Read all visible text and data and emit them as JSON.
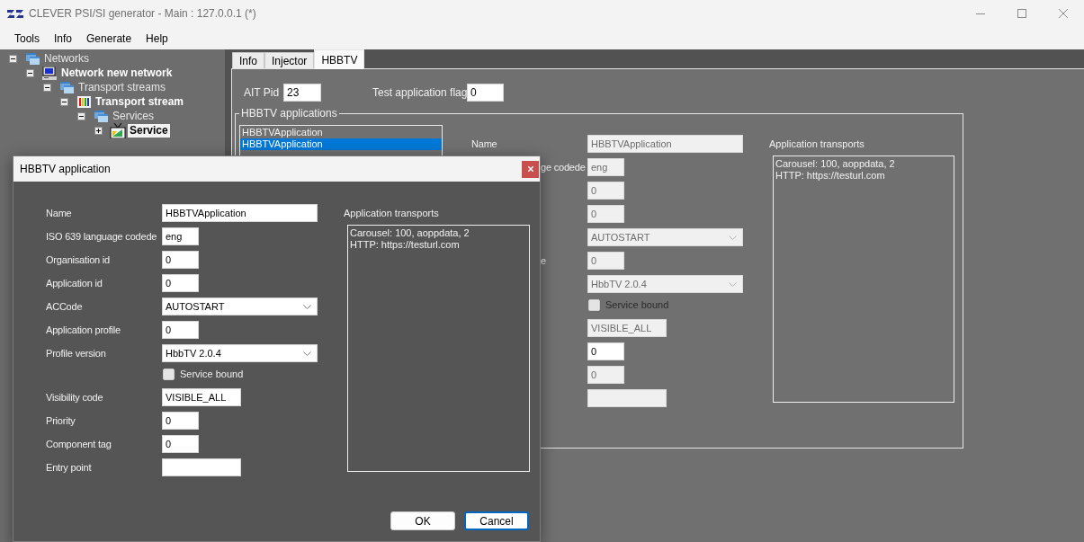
{
  "window": {
    "title": "CLEVER PSI/SI generator - Main : 127.0.0.1 (*)"
  },
  "menu": [
    {
      "label": "Tools"
    },
    {
      "label": "Info"
    },
    {
      "label": "Generate"
    },
    {
      "label": "Help"
    }
  ],
  "tree": [
    {
      "label": "Networks",
      "kind": "folder",
      "expanded": true,
      "selected": false,
      "children": [
        {
          "label": "Network new network",
          "kind": "network",
          "expanded": true,
          "selected": false,
          "children": [
            {
              "label": "Transport streams",
              "kind": "folder",
              "expanded": true,
              "selected": false,
              "children": [
                {
                  "label": "Transport stream",
                  "kind": "stream",
                  "expanded": true,
                  "selected": false,
                  "children": [
                    {
                      "label": "Services",
                      "kind": "folder",
                      "expanded": true,
                      "selected": false,
                      "children": [
                        {
                          "label": "Service",
                          "kind": "service",
                          "expanded": false,
                          "selected": true
                        }
                      ]
                    }
                  ]
                }
              ]
            }
          ]
        }
      ]
    }
  ],
  "tabs": [
    {
      "label": "Info",
      "selected": false
    },
    {
      "label": "Injector",
      "selected": false
    },
    {
      "label": "HBBTV",
      "selected": true
    }
  ],
  "hbbtv_page": {
    "ait_pid": {
      "label": "AIT Pid",
      "value": "23"
    },
    "test_application_flag": {
      "label": "Test application flag",
      "value": "0"
    },
    "applications": {
      "title": "HBBTV applications",
      "items": [
        {
          "label": "HBBTVApplication",
          "selected": false
        },
        {
          "label": "HBBTVApplication",
          "selected": true
        }
      ]
    },
    "details": [
      {
        "kind": "text",
        "label": "Name",
        "label_cut": false,
        "value": "HBBTVApplication",
        "disabled": true
      },
      {
        "kind": "text",
        "label": "ge codede",
        "label_cut": true,
        "value": "eng",
        "disabled": true
      },
      {
        "kind": "text",
        "value": "0",
        "disabled": true
      },
      {
        "kind": "text",
        "value": "0",
        "disabled": true
      },
      {
        "kind": "select",
        "value": "AUTOSTART",
        "disabled": true
      },
      {
        "kind": "text",
        "label": "e",
        "label_cut": true,
        "value": "0",
        "disabled": true
      },
      {
        "kind": "select",
        "value": "HbbTV 2.0.4",
        "disabled": true
      },
      {
        "kind": "checkbox",
        "label": "Service bound",
        "checked": false,
        "disabled": true
      },
      {
        "kind": "text",
        "value": "VISIBLE_ALL",
        "disabled": true
      },
      {
        "kind": "text",
        "value": "0",
        "disabled": false
      },
      {
        "kind": "text",
        "value": "0",
        "disabled": true
      },
      {
        "kind": "text",
        "disabled": true
      }
    ],
    "transports": {
      "title": "Application transports",
      "items": [
        "Carousel: 100, aoppdata, 2",
        "HTTP: https://testurl.com"
      ]
    }
  },
  "dialog": {
    "title": "HBBTV application",
    "fields": [
      {
        "kind": "text",
        "label": "Name",
        "value": "HBBTVApplication",
        "disabled": false
      },
      {
        "kind": "text",
        "label": "ISO 639 language codede",
        "value": "eng",
        "disabled": false
      },
      {
        "kind": "text",
        "label": "Organisation id",
        "value": "0",
        "disabled": false
      },
      {
        "kind": "text",
        "label": "Application id",
        "value": "0",
        "disabled": false
      },
      {
        "kind": "select",
        "label": "ACCode",
        "value": "AUTOSTART",
        "disabled": false
      },
      {
        "kind": "text",
        "label": "Application profile",
        "value": "0",
        "disabled": false
      },
      {
        "kind": "select",
        "label": "Profile version",
        "value": "HbbTV 2.0.4",
        "disabled": false
      },
      {
        "kind": "checkbox",
        "label": "Service bound",
        "checked": false,
        "disabled": false
      },
      {
        "kind": "text",
        "label": "Visibility code",
        "value": "VISIBLE_ALL",
        "disabled": false
      },
      {
        "kind": "text",
        "label": "Priority",
        "value": "0",
        "disabled": false
      },
      {
        "kind": "text",
        "label": "Component tag",
        "value": "0",
        "disabled": false
      },
      {
        "kind": "text",
        "label": "Entry point",
        "disabled": false
      }
    ],
    "transports": {
      "title": "Application transports",
      "items": [
        "Carousel: 100, aoppdata, 2",
        "HTTP: https://testurl.com"
      ]
    },
    "buttons": [
      {
        "label": "OK",
        "focused": false
      },
      {
        "label": "Cancel",
        "focused": true
      }
    ]
  }
}
